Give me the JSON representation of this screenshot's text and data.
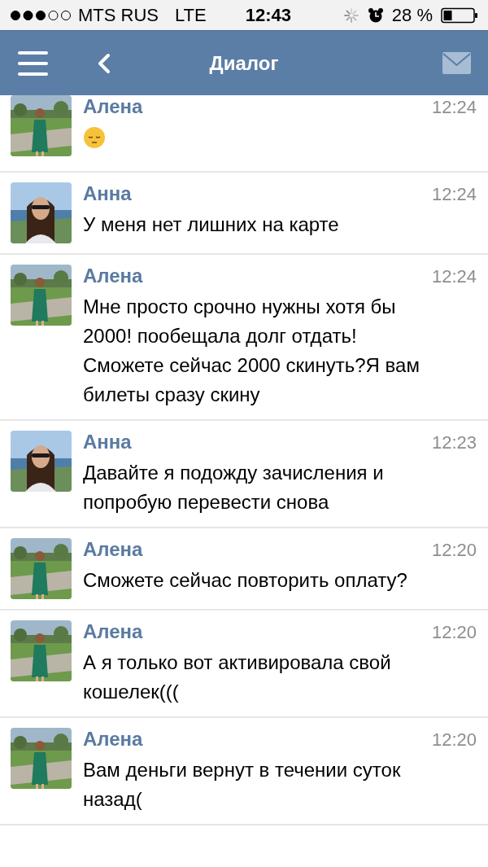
{
  "status_bar": {
    "carrier": "MTS RUS",
    "network": "LTE",
    "time": "12:43",
    "battery": "28 %"
  },
  "header": {
    "title": "Диалог"
  },
  "messages": [
    {
      "author": "Алена",
      "time": "12:24",
      "kind": "emoji"
    },
    {
      "author": "Анна",
      "time": "12:24",
      "text": "У меня нет лишних на карте",
      "kind": "text"
    },
    {
      "author": "Алена",
      "time": "12:24",
      "text": "Мне просто срочно нужны хотя бы 2000! пообещала долг отдать! Сможете сейчас 2000 скинуть?Я вам билеты сразу скину",
      "kind": "text"
    },
    {
      "author": "Анна",
      "time": "12:23",
      "text": "Давайте я подожду зачисления и попробую перевести снова",
      "kind": "text"
    },
    {
      "author": "Алена",
      "time": "12:20",
      "text": "Сможете сейчас повторить оплату?",
      "kind": "text"
    },
    {
      "author": "Алена",
      "time": "12:20",
      "text": "А я только вот активировала свой кошелек(((",
      "kind": "text"
    },
    {
      "author": "Алена",
      "time": "12:20",
      "text": "Вам деньги вернут в течении суток назад(",
      "kind": "text"
    }
  ]
}
